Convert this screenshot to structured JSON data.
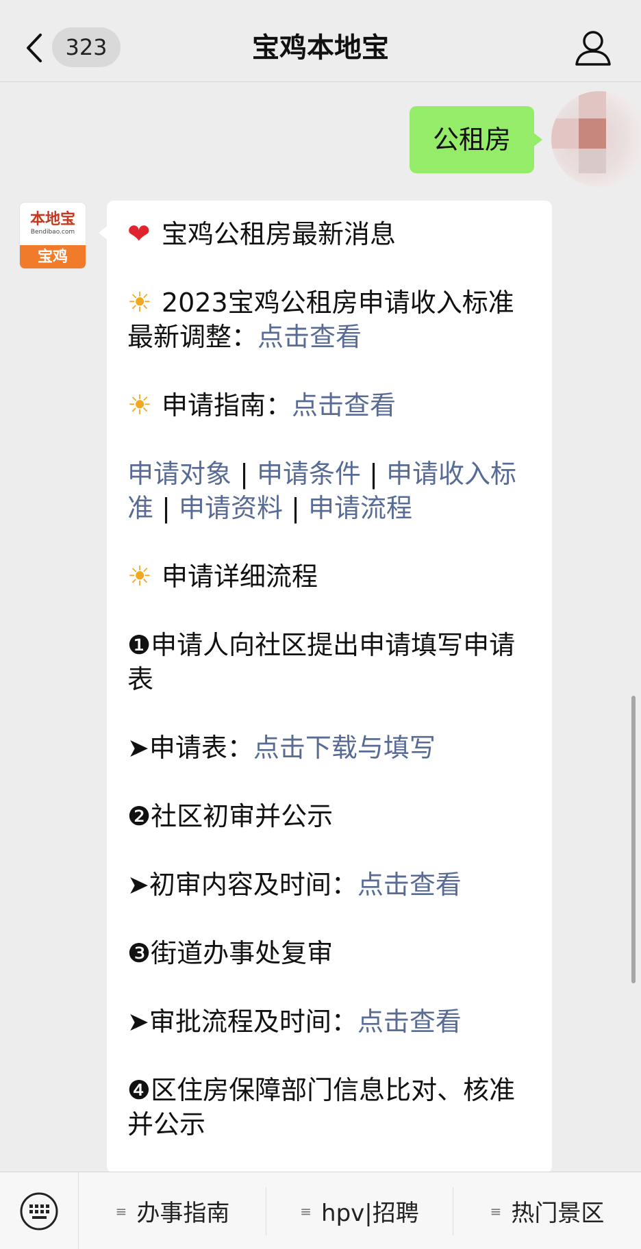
{
  "header": {
    "back_icon": "chevron-left-icon",
    "unread_count": "323",
    "title": "宝鸡本地宝",
    "profile_icon": "person-icon"
  },
  "chat": {
    "user_message": "公租房",
    "bot_avatar": {
      "logo_text": "本地宝",
      "logo_url": "Bendibao.com",
      "city": "宝鸡"
    },
    "bot_message": {
      "headline": "宝鸡公租房最新消息",
      "income_line": "2023宝鸡公租房申请收入标准最新调整：",
      "income_link": "点击查看",
      "guide_line": "申请指南：",
      "guide_link": "点击查看",
      "links": [
        "申请对象",
        "申请条件",
        "申请收入标准",
        "申请资料",
        "申请流程"
      ],
      "separator": "|",
      "process_title": "申请详细流程",
      "step1": "❶申请人向社区提出申请填写申请表",
      "form_line": "➤申请表：",
      "form_link": "点击下载与填写",
      "step2": "❷社区初审并公示",
      "review_line": "➤初审内容及时间：",
      "review_link": "点击查看",
      "step3": "❸街道办事处复审",
      "approval_line": "➤审批流程及时间：",
      "approval_link": "点击查看",
      "step4": "❹区住房保障部门信息比对、核准并公示"
    }
  },
  "bottom_menu": {
    "keyboard_icon": "keyboard-icon",
    "items": [
      "办事指南",
      "hpv|招聘",
      "热门景区"
    ]
  },
  "colors": {
    "link": "#576b95",
    "user_bubble": "#95ec69",
    "heart": "#e0242e",
    "sun": "#f0a81e"
  }
}
